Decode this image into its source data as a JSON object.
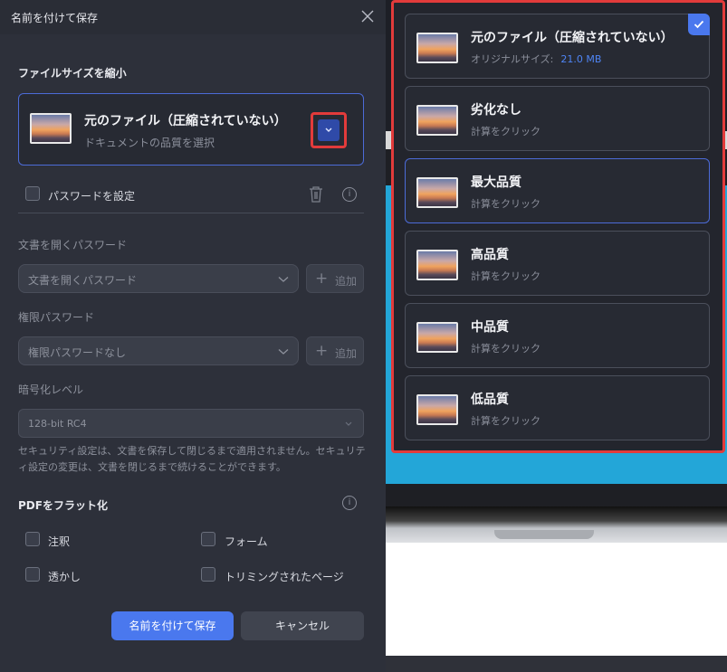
{
  "dialog": {
    "title": "名前を付けて保存",
    "reduce_section_title": "ファイルサイズを縮小",
    "selected_quality": {
      "title": "元のファイル（圧縮されていない）",
      "subtitle": "ドキュメントの品質を選択"
    },
    "password_checkbox_label": "パスワードを設定",
    "open_password_label": "文書を開くパスワード",
    "open_password_placeholder": "文書を開くパスワード",
    "add_label": "追加",
    "permission_password_label": "権限パスワード",
    "permission_password_placeholder": "権限パスワードなし",
    "encryption_label": "暗号化レベル",
    "encryption_value": "128-bit RC4",
    "security_note": "セキュリティ設定は、文書を保存して閉じるまで適用されません。セキュリティ設定の変更は、文書を閉じるまで続けることができます。",
    "flatten_section_title": "PDFをフラット化",
    "flatten_options": [
      "注釈",
      "フォーム",
      "透かし",
      "トリミングされたページ"
    ],
    "save_button": "名前を付けて保存",
    "cancel_button": "キャンセル"
  },
  "quality_options": [
    {
      "title": "元のファイル（圧縮されていない）",
      "subtitle": "オリジナルサイズ:",
      "size": "21.0 MB",
      "selected": true
    },
    {
      "title": "劣化なし",
      "subtitle": "計算をクリック"
    },
    {
      "title": "最大品質",
      "subtitle": "計算をクリック",
      "highlighted": true
    },
    {
      "title": "高品質",
      "subtitle": "計算をクリック"
    },
    {
      "title": "中品質",
      "subtitle": "計算をクリック"
    },
    {
      "title": "低品質",
      "subtitle": "計算をクリック"
    }
  ],
  "colors": {
    "accent": "#4a78ee",
    "highlight_border": "#e23b3b",
    "panel": "#2d303a"
  }
}
